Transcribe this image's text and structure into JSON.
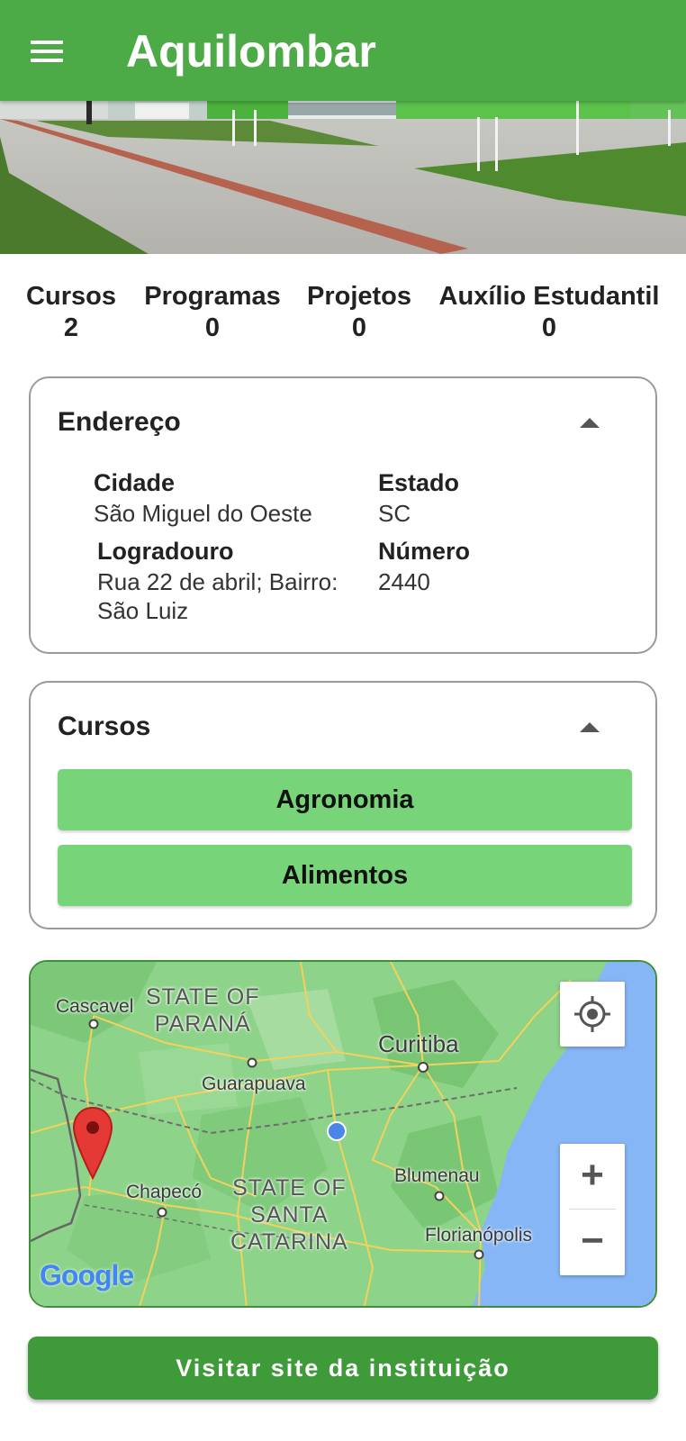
{
  "app": {
    "title": "Aquilombar",
    "menu_icon": "hamburger-menu-icon",
    "brand_color": "#4caa47"
  },
  "stats": [
    {
      "label": "Cursos",
      "count": "2"
    },
    {
      "label": "Programas",
      "count": "0"
    },
    {
      "label": "Projetos",
      "count": "0"
    },
    {
      "label": "Auxílio Estudantil",
      "count": "0"
    }
  ],
  "address": {
    "title": "Endereço",
    "city_label": "Cidade",
    "city": "São Miguel do Oeste",
    "state_label": "Estado",
    "state": "SC",
    "street_label": "Logradouro",
    "street_line1": "Rua 22 de abril; Bairro:",
    "street_line2": "São Luiz",
    "number_label": "Número",
    "number": "2440"
  },
  "courses": {
    "title": "Cursos",
    "items": [
      "Agronomia",
      "Alimentos"
    ],
    "button_color": "#78d478"
  },
  "map": {
    "state_parana_line1": "STATE OF",
    "state_parana_line2": "PARANÁ",
    "state_sc_line1": "STATE OF",
    "state_sc_line2": "SANTA",
    "state_sc_line3": "CATARINA",
    "cities": {
      "cascavel": "Cascavel",
      "curitiba": "Curitiba",
      "guarapuava": "Guarapuava",
      "chapeco": "Chapecó",
      "blumenau": "Blumenau",
      "florianopolis": "Florianópolis"
    },
    "attribution": "Google",
    "zoom_in": "+",
    "zoom_out": "−",
    "land_color": "#8ed38a",
    "water_color": "#86b6f5"
  },
  "visit_button": "Visitar site da instituição"
}
